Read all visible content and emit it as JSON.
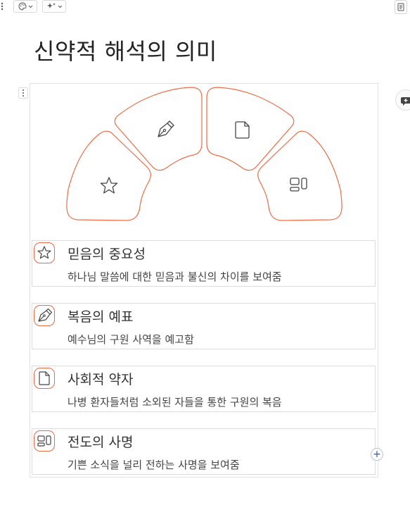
{
  "title": "신약적 해석의 의미",
  "toolbar": {
    "left_icons": [
      "more-vertical-icon",
      "palette-icon",
      "chevron-down-icon",
      "sparkles-icon",
      "chevron-down-icon"
    ],
    "right_icon": "notes-icon"
  },
  "accent_color": "#f06a45",
  "segments": [
    {
      "icon": "star-icon"
    },
    {
      "icon": "pen-nib-icon"
    },
    {
      "icon": "document-icon"
    },
    {
      "icon": "layout-icon"
    }
  ],
  "items": [
    {
      "title": "믿음의 중요성",
      "desc": "하나님 말씀에 대한 믿음과 불신의 차이를 보여줌",
      "icon": "star-icon"
    },
    {
      "title": "복음의 예표",
      "desc": "예수님의 구원 사역을 예고함",
      "icon": "pen-nib-icon"
    },
    {
      "title": "사회적 약자",
      "desc": "나병 환자들처럼 소외된 자들을 통한 구원의 복음",
      "icon": "document-icon"
    },
    {
      "title": "전도의 사명",
      "desc": "기쁜 소식을 널리 전하는 사명을 보여줌",
      "icon": "layout-icon"
    }
  ],
  "add_button_label": "+"
}
